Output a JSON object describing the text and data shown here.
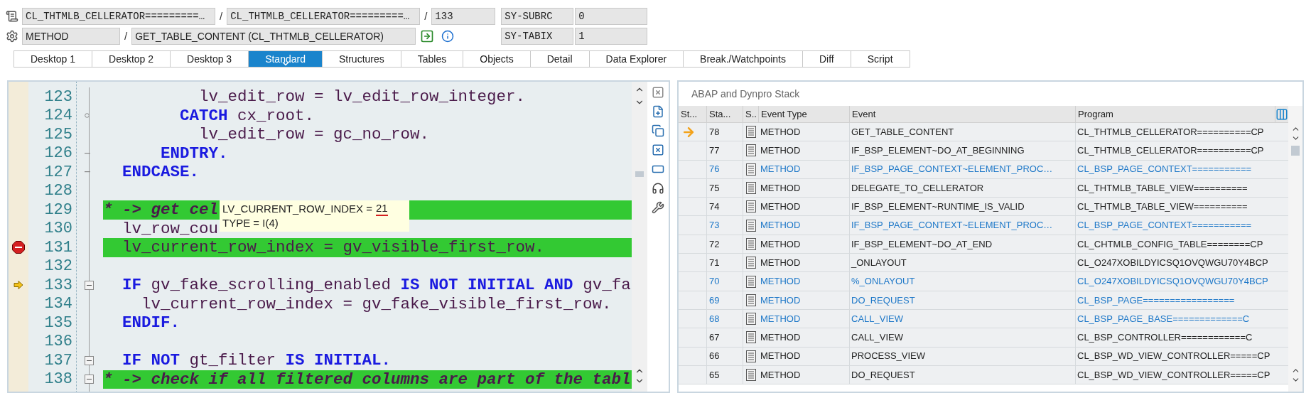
{
  "header": {
    "separators": [
      "/",
      "/",
      "/"
    ],
    "program": "CL_THTMLB_CELLERATOR=========…",
    "include": "CL_THTMLB_CELLERATOR=========…",
    "line": "133",
    "event_type": "METHOD",
    "event": "GET_TABLE_CONTENT (CL_THTMLB_CELLERATOR)",
    "system_fields": [
      {
        "name": "SY-SUBRC",
        "value": "0"
      },
      {
        "name": "SY-TABIX",
        "value": "1"
      }
    ]
  },
  "tabs": [
    {
      "label": "Desktop 1",
      "selected": false
    },
    {
      "label": "Desktop 2",
      "selected": false
    },
    {
      "label": "Desktop 3",
      "selected": false
    },
    {
      "label": "Standard",
      "selected": true
    },
    {
      "label": "Structures",
      "selected": false
    },
    {
      "label": "Tables",
      "selected": false
    },
    {
      "label": "Objects",
      "selected": false
    },
    {
      "label": "Detail",
      "selected": false
    },
    {
      "label": "Data Explorer",
      "selected": false
    },
    {
      "label": "Break./Watchpoints",
      "selected": false
    },
    {
      "label": "Diff",
      "selected": false
    },
    {
      "label": "Script",
      "selected": false
    }
  ],
  "editor": {
    "lines": [
      {
        "number": "123",
        "collapse_button": false,
        "block_end": false,
        "block_node": false,
        "highlighted": false,
        "breakpoint": false,
        "current": false,
        "segments": [
          {
            "kind": "id",
            "text": "          lv_edit_row = lv_edit_row_integer."
          }
        ]
      },
      {
        "number": "124",
        "collapse_button": false,
        "block_end": false,
        "block_node": true,
        "highlighted": false,
        "breakpoint": false,
        "current": false,
        "segments": [
          {
            "kind": "kw",
            "text": "        CATCH"
          },
          {
            "kind": "id",
            "text": " cx_root."
          }
        ]
      },
      {
        "number": "125",
        "collapse_button": false,
        "block_end": false,
        "block_node": false,
        "highlighted": false,
        "breakpoint": false,
        "current": false,
        "segments": [
          {
            "kind": "id",
            "text": "          lv_edit_row = gc_no_row."
          }
        ]
      },
      {
        "number": "126",
        "collapse_button": false,
        "block_end": true,
        "block_node": false,
        "highlighted": false,
        "breakpoint": false,
        "current": false,
        "segments": [
          {
            "kind": "kw",
            "text": "      ENDTRY."
          }
        ]
      },
      {
        "number": "127",
        "collapse_button": false,
        "block_end": true,
        "block_node": false,
        "highlighted": false,
        "breakpoint": false,
        "current": false,
        "segments": [
          {
            "kind": "kw",
            "text": "  ENDCASE."
          }
        ]
      },
      {
        "number": "128",
        "collapse_button": false,
        "block_end": false,
        "block_node": false,
        "highlighted": false,
        "breakpoint": false,
        "current": false
      },
      {
        "number": "129",
        "collapse_button": false,
        "block_end": false,
        "block_node": false,
        "highlighted": true,
        "breakpoint": false,
        "current": false,
        "segments": [
          {
            "kind": "comment",
            "text": "* -> get cel"
          }
        ]
      },
      {
        "number": "130",
        "collapse_button": false,
        "block_end": false,
        "block_node": false,
        "highlighted": false,
        "breakpoint": false,
        "current": false,
        "segments": [
          {
            "kind": "id",
            "text": "  lv_row_cou"
          }
        ]
      },
      {
        "number": "131",
        "collapse_button": false,
        "block_end": false,
        "block_node": false,
        "highlighted": true,
        "breakpoint": true,
        "current": false,
        "segments": [
          {
            "kind": "id",
            "text": "  lv_current_row_index = gv_visible_first_row."
          }
        ]
      },
      {
        "number": "132",
        "collapse_button": false,
        "block_end": false,
        "block_node": false,
        "highlighted": false,
        "breakpoint": false,
        "current": false
      },
      {
        "number": "133",
        "collapse_button": true,
        "block_end": false,
        "block_node": false,
        "highlighted": false,
        "breakpoint": false,
        "current": true,
        "segments": [
          {
            "kind": "kw",
            "text": "  IF"
          },
          {
            "kind": "id",
            "text": " gv_fake_scrolling_enabled "
          },
          {
            "kind": "kw",
            "text": "IS NOT INITIAL AND"
          },
          {
            "kind": "id",
            "text": " gv_fa"
          }
        ]
      },
      {
        "number": "134",
        "collapse_button": false,
        "block_end": false,
        "block_node": false,
        "highlighted": false,
        "breakpoint": false,
        "current": false,
        "segments": [
          {
            "kind": "id",
            "text": "    lv_current_row_index = gv_fake_visible_first_row."
          }
        ]
      },
      {
        "number": "135",
        "collapse_button": false,
        "block_end": false,
        "block_node": false,
        "highlighted": false,
        "breakpoint": false,
        "current": false,
        "segments": [
          {
            "kind": "kw",
            "text": "  ENDIF."
          }
        ]
      },
      {
        "number": "136",
        "collapse_button": false,
        "block_end": false,
        "block_node": false,
        "highlighted": false,
        "breakpoint": false,
        "current": false
      },
      {
        "number": "137",
        "collapse_button": true,
        "block_end": false,
        "block_node": false,
        "highlighted": false,
        "breakpoint": false,
        "current": false,
        "segments": [
          {
            "kind": "kw",
            "text": "  IF NOT"
          },
          {
            "kind": "id",
            "text": " gt_filter "
          },
          {
            "kind": "kw",
            "text": "IS INITIAL."
          }
        ]
      },
      {
        "number": "138",
        "collapse_button": true,
        "block_end": false,
        "block_node": false,
        "highlighted": true,
        "breakpoint": false,
        "current": false,
        "segments": [
          {
            "kind": "comment",
            "text": "* -> check if all filtered columns are part of the tabl"
          }
        ]
      }
    ],
    "tooltip": {
      "name": "LV_CURRENT_ROW_INDEX =",
      "value": "21",
      "type": "TYPE = I(4)"
    }
  },
  "stack": {
    "title": "ABAP and Dynpro Stack",
    "columns": [
      "St...",
      "Sta...",
      "S..",
      "Event Type",
      "Event",
      "Program"
    ],
    "rows": [
      {
        "current": true,
        "system": false,
        "number": "78",
        "type": "METHOD",
        "event": "GET_TABLE_CONTENT",
        "program": "CL_THTMLB_CELLERATOR==========CP"
      },
      {
        "current": false,
        "system": false,
        "number": "77",
        "type": "METHOD",
        "event": "IF_BSP_ELEMENT~DO_AT_BEGINNING",
        "program": "CL_THTMLB_CELLERATOR==========CP"
      },
      {
        "current": false,
        "system": true,
        "number": "76",
        "type": "METHOD",
        "event": "IF_BSP_PAGE_CONTEXT~ELEMENT_PROC…",
        "program": "CL_BSP_PAGE_CONTEXT==========="
      },
      {
        "current": false,
        "system": false,
        "number": "75",
        "type": "METHOD",
        "event": "DELEGATE_TO_CELLERATOR",
        "program": "CL_THTMLB_TABLE_VIEW=========="
      },
      {
        "current": false,
        "system": false,
        "number": "74",
        "type": "METHOD",
        "event": "IF_BSP_ELEMENT~RUNTIME_IS_VALID",
        "program": "CL_THTMLB_TABLE_VIEW=========="
      },
      {
        "current": false,
        "system": true,
        "number": "73",
        "type": "METHOD",
        "event": "IF_BSP_PAGE_CONTEXT~ELEMENT_PROC…",
        "program": "CL_BSP_PAGE_CONTEXT==========="
      },
      {
        "current": false,
        "system": false,
        "number": "72",
        "type": "METHOD",
        "event": "IF_BSP_ELEMENT~DO_AT_END",
        "program": "CL_CHTMLB_CONFIG_TABLE========CP"
      },
      {
        "current": false,
        "system": false,
        "number": "71",
        "type": "METHOD",
        "event": "_ONLAYOUT",
        "program": "CL_O247XOBILDYICSQ1OVQWGU70Y4BCP"
      },
      {
        "current": false,
        "system": true,
        "number": "70",
        "type": "METHOD",
        "event": "%_ONLAYOUT",
        "program": "CL_O247XOBILDYICSQ1OVQWGU70Y4BCP"
      },
      {
        "current": false,
        "system": true,
        "number": "69",
        "type": "METHOD",
        "event": "DO_REQUEST",
        "program": "CL_BSP_PAGE================="
      },
      {
        "current": false,
        "system": true,
        "number": "68",
        "type": "METHOD",
        "event": "CALL_VIEW",
        "program": "CL_BSP_PAGE_BASE=============C"
      },
      {
        "current": false,
        "system": false,
        "number": "67",
        "type": "METHOD",
        "event": "CALL_VIEW",
        "program": "CL_BSP_CONTROLLER============C"
      },
      {
        "current": false,
        "system": false,
        "number": "66",
        "type": "METHOD",
        "event": "PROCESS_VIEW",
        "program": "CL_BSP_WD_VIEW_CONTROLLER=====CP"
      },
      {
        "current": false,
        "system": false,
        "number": "65",
        "type": "METHOD",
        "event": "DO_REQUEST",
        "program": "CL_BSP_WD_VIEW_CONTROLLER=====CP"
      }
    ]
  }
}
